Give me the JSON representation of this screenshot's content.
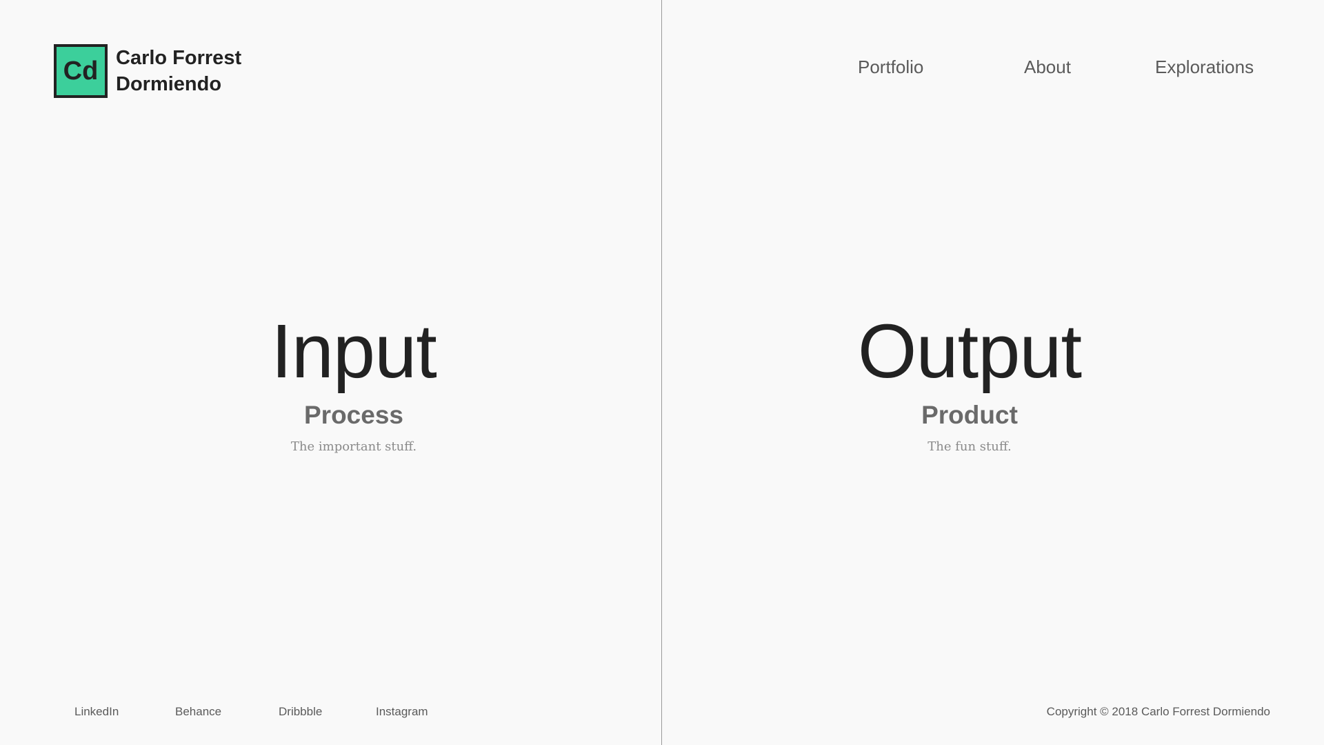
{
  "brand": {
    "logo_mark": "Cd",
    "name_line1": "Carlo Forrest",
    "name_line2": "Dormiendo",
    "accent_color": "#3ccf9b"
  },
  "nav": {
    "items": [
      {
        "label": "Portfolio"
      },
      {
        "label": "About"
      },
      {
        "label": "Explorations"
      }
    ]
  },
  "left_panel": {
    "title": "Input",
    "subtitle": "Process",
    "description": "The important stuff."
  },
  "right_panel": {
    "title": "Output",
    "subtitle": "Product",
    "description": "The fun stuff."
  },
  "footer": {
    "social": [
      {
        "label": "LinkedIn"
      },
      {
        "label": "Behance"
      },
      {
        "label": "Dribbble"
      },
      {
        "label": "Instagram"
      }
    ],
    "copyright": "Copyright © 2018 Carlo Forrest Dormiendo"
  }
}
